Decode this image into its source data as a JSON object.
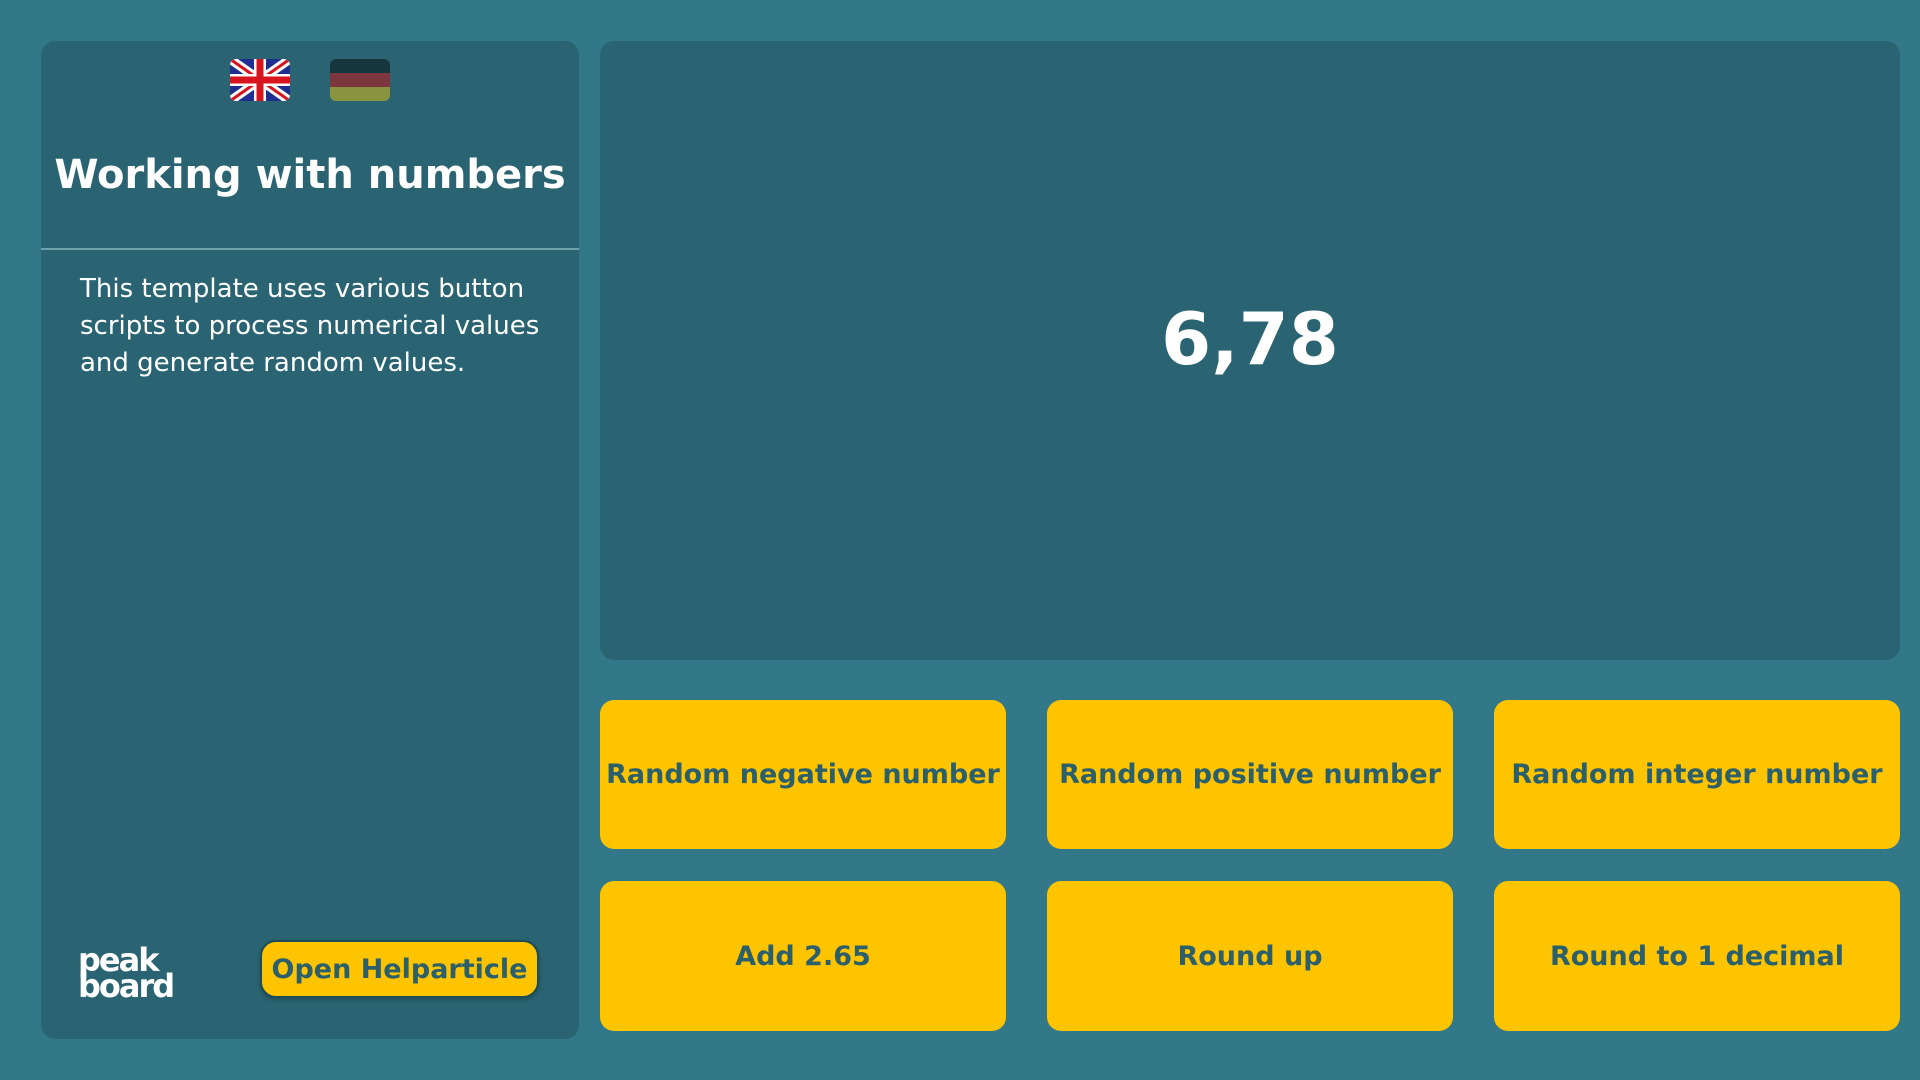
{
  "sidebar": {
    "languages": [
      {
        "name": "English",
        "icon": "uk-flag-icon",
        "active": true
      },
      {
        "name": "German",
        "icon": "german-flag-icon",
        "active": false
      }
    ],
    "title": "Working with numbers",
    "description": "This template uses various button scripts to process numerical values and generate random values.",
    "logo_line1": "peak",
    "logo_line2": "board",
    "help_button_label": "Open Helparticle"
  },
  "display": {
    "value": "6,78"
  },
  "buttons": [
    {
      "label": "Random negative number"
    },
    {
      "label": "Random positive number"
    },
    {
      "label": "Random integer number"
    },
    {
      "label": "Add 2.65"
    },
    {
      "label": "Round up"
    },
    {
      "label": "Round to 1 decimal"
    }
  ],
  "colors": {
    "background": "#337888",
    "panel": "#2a6472",
    "accent": "#ffc400",
    "button_text": "#2b5f6b",
    "text": "#ffffff"
  }
}
